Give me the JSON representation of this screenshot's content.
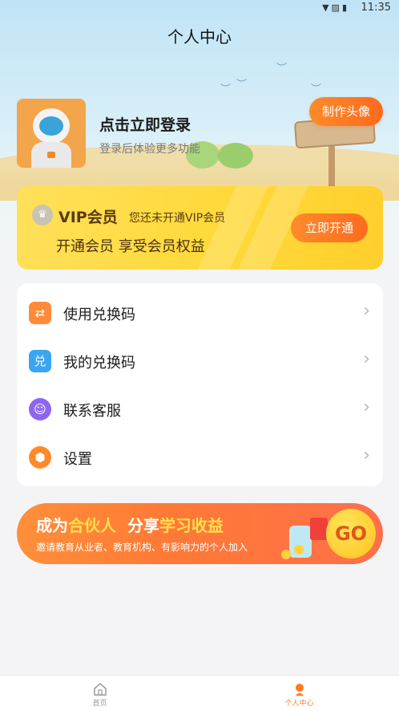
{
  "status_bar": {
    "time": "11:35",
    "icons": [
      "wifi-icon",
      "no-sim-icon",
      "battery-icon"
    ]
  },
  "page_title": "个人中心",
  "profile": {
    "login_title": "点击立即登录",
    "login_subtitle": "登录后体验更多功能",
    "make_avatar_label": "制作头像"
  },
  "vip": {
    "title": "VIP会员",
    "status": "您还未开通VIP会员",
    "benefit": "开通会员 享受会员权益",
    "open_label": "立即开通"
  },
  "menu": {
    "items": [
      {
        "label": "使用兑换码",
        "icon": "ticket-icon",
        "color": "#ff8a3a"
      },
      {
        "label": "我的兑换码",
        "icon": "redeem-icon",
        "color": "#3aa5f0"
      },
      {
        "label": "联系客服",
        "icon": "headset-icon",
        "color": "#8f65f0"
      },
      {
        "label": "设置",
        "icon": "settings-icon",
        "color": "#ff8a2a"
      }
    ]
  },
  "partner": {
    "title_part1": "成为",
    "title_highlight1": "合伙人",
    "title_part2": "分享",
    "title_highlight2": "学习收益",
    "subtitle": "邀请教育从业者、教育机构、有影响力的个人加入",
    "go_label": "GO"
  },
  "tabbar": {
    "tabs": [
      {
        "label": "首页",
        "icon": "home-icon",
        "active": false
      },
      {
        "label": "个人中心",
        "icon": "user-icon",
        "active": true
      }
    ]
  },
  "colors": {
    "accent": "#ff7a1f",
    "vip_yellow": "#ffd93a",
    "banner_orange": "#ff7a35"
  }
}
